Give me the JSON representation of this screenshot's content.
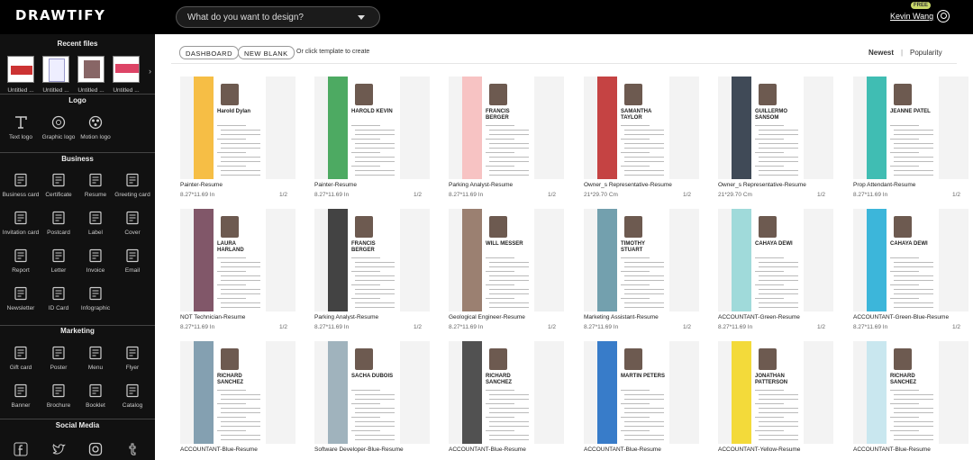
{
  "app": {
    "logo": "DRAWTIFY",
    "search_placeholder": "What do you want to design?",
    "user_name": "Kevin Wang",
    "plan_badge": "FREE"
  },
  "sidebar": {
    "sections": {
      "recent": "Recent files",
      "logo": "Logo",
      "business": "Business",
      "marketing": "Marketing",
      "social": "Social Media"
    },
    "recent_files": [
      "Untitled ...",
      "Untitled ...",
      "Untitled ...",
      "Untitled ..."
    ],
    "logo_items": [
      "Text logo",
      "Graphic logo",
      "Motion logo"
    ],
    "business_items": [
      "Business card",
      "Certificate",
      "Resume",
      "Greeting card",
      "Invitation card",
      "Postcard",
      "Label",
      "Cover",
      "Report",
      "Letter",
      "Invoice",
      "Email",
      "Newsletter",
      "ID Card",
      "Infographic"
    ],
    "marketing_items": [
      "Gift card",
      "Poster",
      "Menu",
      "Flyer",
      "Banner",
      "Brochure",
      "Booklet",
      "Catalog"
    ]
  },
  "toolbar": {
    "dashboard": "DASHBOARD",
    "new_blank": "NEW BLANK",
    "hint": "Or click template to create",
    "sort_newest": "Newest",
    "sort_separator": "|",
    "sort_popularity": "Popularity"
  },
  "templates": [
    {
      "name": "Painter-Resume",
      "size": "8.27*11.69 In",
      "pages": "1/2",
      "accent": "#f5b324"
    },
    {
      "name": "Painter-Resume",
      "size": "8.27*11.69 In",
      "pages": "1/2",
      "accent": "#2e9b47"
    },
    {
      "name": "Parking Analyst-Resume",
      "size": "8.27*11.69 In",
      "pages": "1/2",
      "accent": "#f6b8b8"
    },
    {
      "name": "Owner_s Representative-Resume",
      "size": "21*29.70 Cm",
      "pages": "1/2",
      "accent": "#b22"
    },
    {
      "name": "Owner_s Representative-Resume",
      "size": "21*29.70 Cm",
      "pages": "1/2",
      "accent": "#1e2a3a"
    },
    {
      "name": "Prop Attendant-Resume",
      "size": "8.27*11.69 In",
      "pages": "1/2",
      "accent": "#1fb1a6"
    },
    {
      "name": "NOT Technician-Resume",
      "size": "8.27*11.69 In",
      "pages": "1/2",
      "accent": "#6b3a4f"
    },
    {
      "name": "Parking Analyst-Resume",
      "size": "8.27*11.69 In",
      "pages": "1/2",
      "accent": "#222"
    },
    {
      "name": "Geological Engineer-Resume",
      "size": "8.27*11.69 In",
      "pages": "1/2",
      "accent": "#8a6a58"
    },
    {
      "name": "Marketing Assistant-Resume",
      "size": "8.27*11.69 In",
      "pages": "1/2",
      "accent": "#5a8fa0"
    },
    {
      "name": "ACCOUNTANT-Green-Resume",
      "size": "8.27*11.69 In",
      "pages": "1/2",
      "accent": "#8fd3d3"
    },
    {
      "name": "ACCOUNTANT-Green-Blue-Resume",
      "size": "8.27*11.69 In",
      "pages": "1/2",
      "accent": "#1aa9d4"
    },
    {
      "name": "ACCOUNTANT-Blue-Resume",
      "size": "",
      "pages": "",
      "accent": "#6f8fa3"
    },
    {
      "name": "Software Developer-Blue-Resume",
      "size": "",
      "pages": "",
      "accent": "#8fa6b1"
    },
    {
      "name": "ACCOUNTANT-Blue-Resume",
      "size": "",
      "pages": "",
      "accent": "#333"
    },
    {
      "name": "ACCOUNTANT-Blue-Resume",
      "size": "",
      "pages": "",
      "accent": "#1565c0"
    },
    {
      "name": "ACCOUNTANT-Yellow-Resume",
      "size": "",
      "pages": "",
      "accent": "#f1d417"
    },
    {
      "name": "ACCOUNTANT-Blue-Resume",
      "size": "",
      "pages": "",
      "accent": "#bfe3ec"
    }
  ],
  "template_headings": {
    "t1": "Harold Dylan",
    "t2": "HAROLD KEVIN",
    "t3": "FRANCIS BERGER",
    "t4": "SAMANTHA TAYLOR",
    "t5": "GUILLERMO SANSOM",
    "t6": "JEANNE PATEL",
    "t7": "LAURA HARLAND",
    "t8": "FRANCIS BERGER",
    "t9": "WILL MESSER",
    "t10": "TIMOTHY STUART",
    "t11": "CAHAYA DEWI",
    "t12": "CAHAYA DEWI",
    "t13": "RICHARD SANCHEZ",
    "t14": "SACHA DUBOIS",
    "t15": "RICHARD SANCHEZ",
    "t16": "MARTIN PETERS",
    "t17": "JONATHAN PATTERSON",
    "t18": "RICHARD SANCHEZ"
  }
}
